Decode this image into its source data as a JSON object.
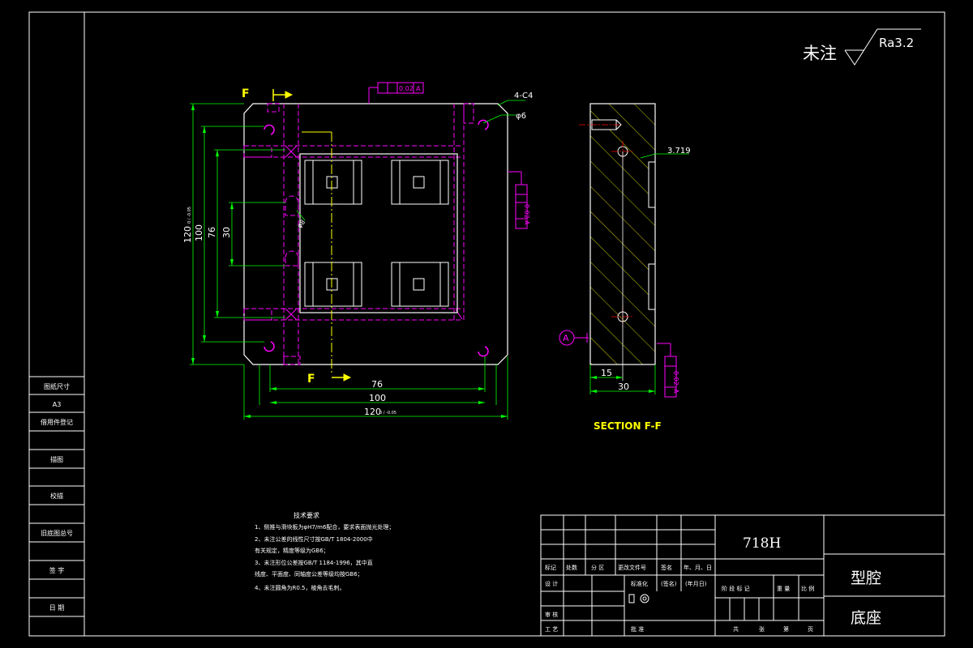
{
  "roughness": {
    "label": "未注",
    "value": "Ra3.2"
  },
  "views": {
    "section_marker": "F",
    "section_title": "SECTION F-F",
    "datum": "A"
  },
  "dimensions": {
    "top_h": [
      "76",
      "100",
      "120"
    ],
    "top_h_tol": "0 / -0.05",
    "top_v": [
      "120",
      "100",
      "76",
      "30"
    ],
    "top_v_tol": "0 / -0.05",
    "chamfer": "4-C4",
    "hole": "φ6",
    "phi8": "φ8",
    "flatness_top": "0.02",
    "flatness_right": "0.02",
    "datum_ref": "A",
    "section_w": [
      "15",
      "30"
    ],
    "section_offset": "3.719",
    "section_flatness": "0.02"
  },
  "notes": {
    "title": "技术要求",
    "items": [
      "1、侧推与滑块板为φH7/m6配合，要求表面抛光处理；",
      "2、未注公差的线性尺寸按GB/T 1804-2000中",
      "   有关规定，精度等级为GB6；",
      "3、未注形位公差按GB/T 1184-1996，其中直",
      "   线度、平面度、同轴度公差等级均按GB6；",
      "4、未注圆角为R0.5，棱角去毛刺。"
    ]
  },
  "left_column": {
    "cells": [
      "图纸尺寸",
      "A3",
      "借用件登记",
      "",
      "描图",
      "",
      "校描",
      "",
      "旧底图总号",
      "",
      "签 字",
      "",
      "日 期",
      ""
    ]
  },
  "title_block": {
    "material": "718H",
    "part_name": "型腔",
    "part_sub": "底座",
    "row_labels": [
      "标记",
      "处数",
      "分 区",
      "更改文件号",
      "签名",
      "年、月、日"
    ],
    "design_row": [
      "设 计",
      "标准化",
      "(签名)",
      "(年月日)",
      "阶 段 标 记",
      "重 量",
      "比 例"
    ],
    "check_row": [
      "审 核"
    ],
    "process_row": [
      "工 艺",
      "批 准"
    ],
    "sheet_row": [
      "共",
      "张",
      "第",
      "页"
    ]
  },
  "colors": {
    "frame": "#ffffff",
    "part": "#ffffff",
    "dimension": "#00ff00",
    "hidden": "#ff00ff",
    "label": "#ffff00",
    "centerline": "#ffff00"
  }
}
